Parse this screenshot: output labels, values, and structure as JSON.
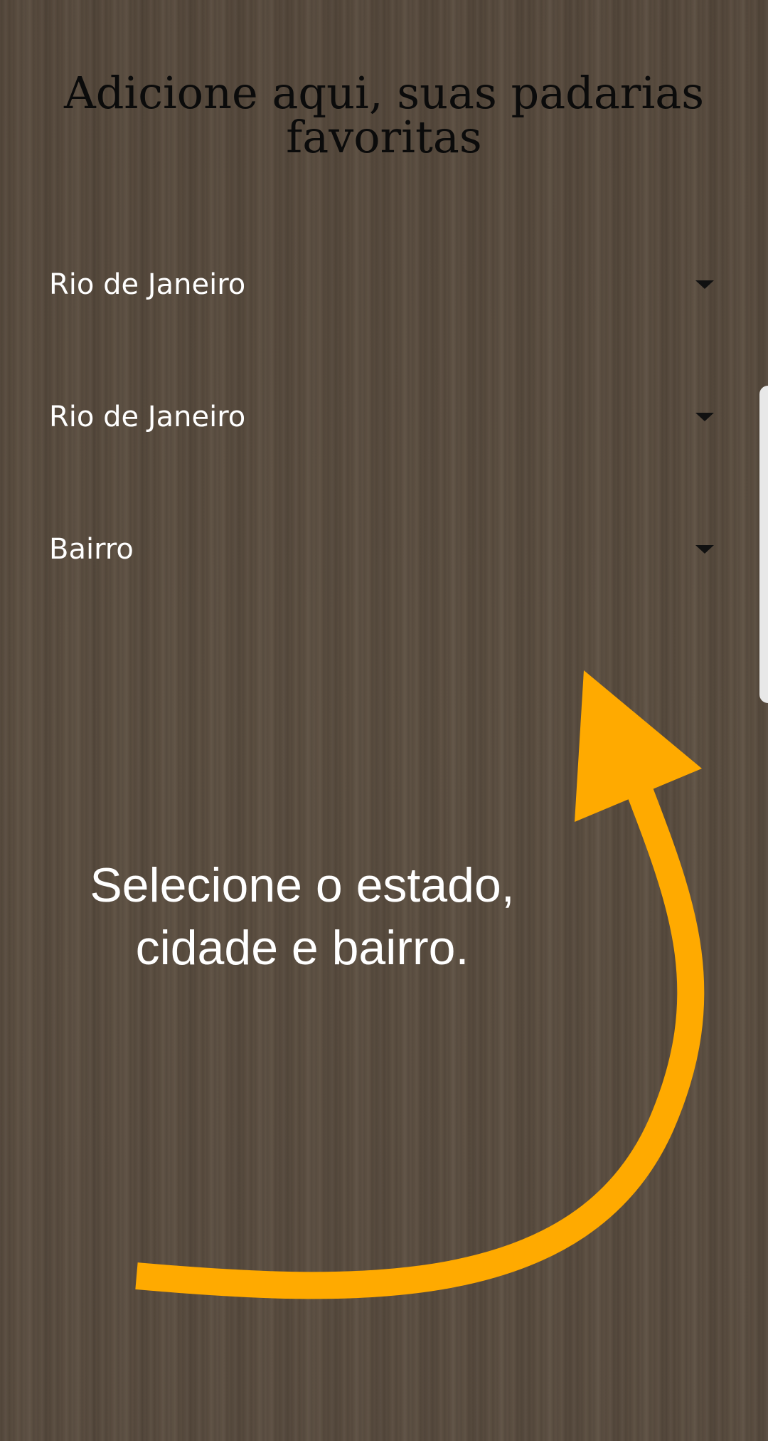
{
  "title": "Adicione aqui, suas padarias favoritas",
  "dropdowns": [
    {
      "value": "Rio de Janeiro"
    },
    {
      "value": "Rio de Janeiro"
    },
    {
      "value": "Bairro"
    }
  ],
  "hint": {
    "line1": "Selecione o estado,",
    "line2": "cidade e bairro."
  },
  "colors": {
    "arrow": "#ffaa00",
    "text": "#ffffff",
    "title": "#0b0b0b"
  },
  "icons": {
    "dropdown_caret": "caret-down-icon",
    "hint_arrow": "curved-arrow-icon"
  }
}
